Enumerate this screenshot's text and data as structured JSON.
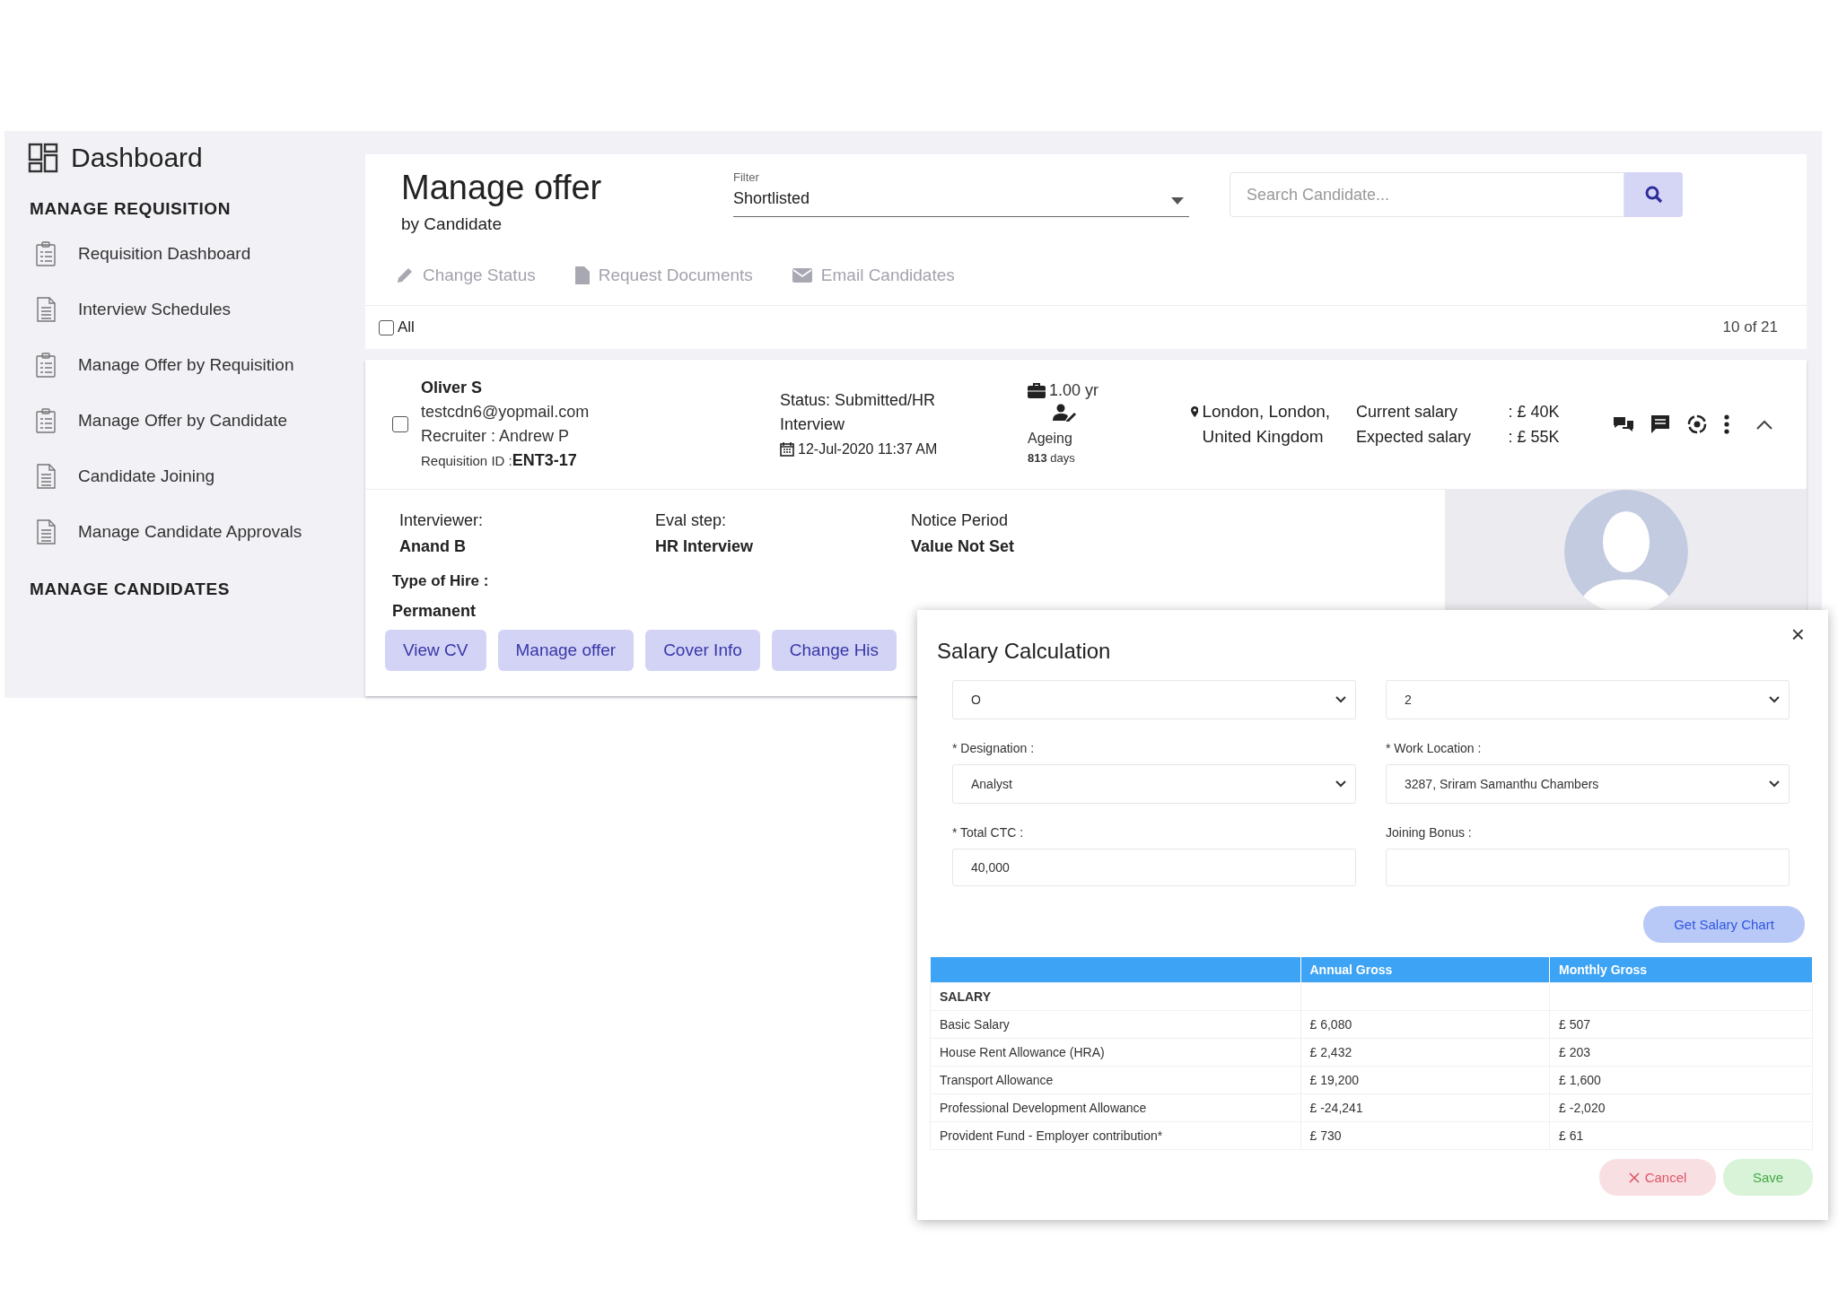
{
  "sidebar": {
    "title": "Dashboard",
    "sections": [
      {
        "heading": "MANAGE REQUISITION",
        "items": [
          {
            "label": "Requisition Dashboard",
            "kind": "clipboard"
          },
          {
            "label": "Interview Schedules",
            "kind": "document"
          },
          {
            "label": "Manage Offer by Requisition",
            "kind": "clipboard"
          },
          {
            "label": "Manage Offer by Candidate",
            "kind": "clipboard"
          },
          {
            "label": "Candidate Joining",
            "kind": "document"
          },
          {
            "label": "Manage Candidate Approvals",
            "kind": "document"
          }
        ]
      },
      {
        "heading": "MANAGE CANDIDATES"
      }
    ]
  },
  "header": {
    "title": "Manage offer",
    "subtitle": "by Candidate",
    "filter": {
      "label": "Filter",
      "value": "Shortlisted"
    },
    "search": {
      "placeholder": "Search Candidate..."
    },
    "actions": [
      {
        "label": "Change Status",
        "kind": "pencil"
      },
      {
        "label": "Request Documents",
        "kind": "file"
      },
      {
        "label": "Email Candidates",
        "kind": "mail"
      }
    ],
    "select_all": {
      "label": "All",
      "checked": false
    },
    "count": "10 of 21"
  },
  "candidate": {
    "checked": false,
    "expanded": true,
    "name": "Oliver S",
    "email": "testcdn6@yopmail.com",
    "recruiter": "Recruiter : Andrew P",
    "requisition": "Requisition ID :**ENT3-17**",
    "status": "Status: Submitted/HR Interview",
    "date": "12-Jul-2020 11:37 AM",
    "experience": "1.00 yr",
    "ageing_label": "Ageing",
    "ageing": "**813** days",
    "location": "London, London, United Kingdom",
    "salaries": [
      {
        "label": "Current salary",
        "value": ": £ 40K"
      },
      {
        "label": "Expected salary",
        "value": ": £ 55K"
      }
    ],
    "details": [
      {
        "label": "Interviewer:",
        "value": "Anand B"
      },
      {
        "label": "Eval step:",
        "value": "HR Interview"
      },
      {
        "label": "Notice Period",
        "value": "Value Not Set"
      }
    ],
    "hire_type": {
      "label": "Type of Hire :",
      "value": "Permanent"
    },
    "buttons": [
      "View CV",
      "Manage offer",
      "Cover Info",
      "Change His"
    ]
  },
  "modal": {
    "title": "Salary Calculation",
    "close": "×",
    "fields": [
      {
        "kind": "select",
        "value": "O"
      },
      {
        "kind": "select",
        "value": "2"
      },
      {
        "kind": "select",
        "label": "* Designation :",
        "value": "Analyst"
      },
      {
        "kind": "select",
        "label": "* Work Location :",
        "value": "3287, Sriram Samanthu Chambers"
      },
      {
        "kind": "input",
        "label": "* Total CTC :",
        "value": "40,000"
      },
      {
        "kind": "input",
        "label": "Joining Bonus :"
      }
    ],
    "chart_button": "Get Salary Chart",
    "table": {
      "columns": [
        "Annual Gross",
        "Monthly Gross"
      ],
      "rows": [
        {
          "kind": "section",
          "label": "SALARY"
        },
        {
          "kind": "item",
          "label": "Basic Salary",
          "annual": "£ 6,080",
          "monthly": "£ 507"
        },
        {
          "kind": "item",
          "label": "House Rent Allowance (HRA)",
          "annual": "£ 2,432",
          "monthly": "£ 203"
        },
        {
          "kind": "item",
          "label": "Transport Allowance",
          "annual": "£ 19,200",
          "monthly": "£ 1,600"
        },
        {
          "kind": "item",
          "label": "Professional Development Allowance",
          "annual": "£ -24,241",
          "monthly": "£ -2,020"
        },
        {
          "kind": "item",
          "label": "Provident Fund - Employer contribution*",
          "annual": "£ 730",
          "monthly": "£ 61"
        }
      ]
    },
    "buttons": [
      {
        "label": "Cancel",
        "kind": "cancel"
      },
      {
        "label": "Save",
        "kind": "save"
      }
    ]
  }
}
